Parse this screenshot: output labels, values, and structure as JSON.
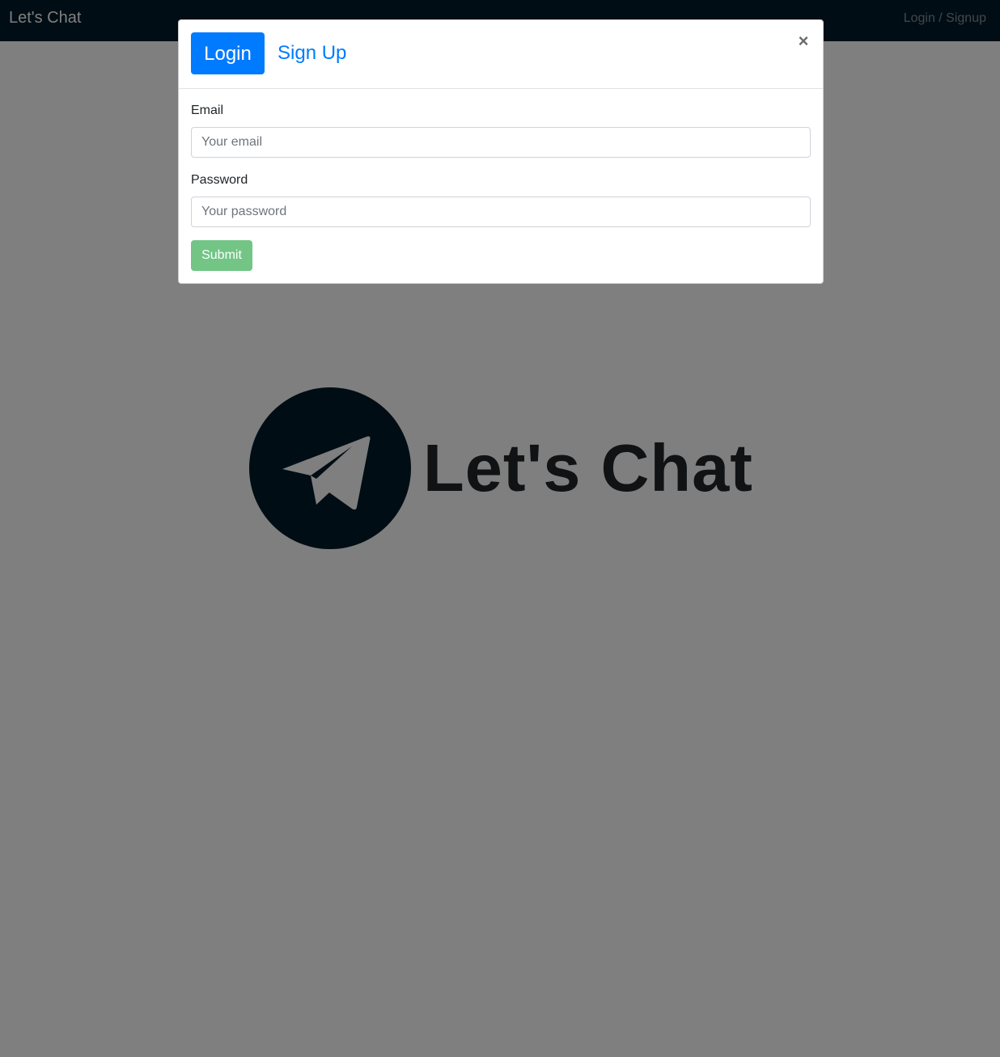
{
  "navbar": {
    "brand": "Let's Chat",
    "login_link": "Login / Signup"
  },
  "hero": {
    "title": "Let's Chat",
    "logo_icon": "paper-plane-icon"
  },
  "modal": {
    "tabs": {
      "login": "Login",
      "signup": "Sign Up"
    },
    "active_tab": "login",
    "close_label": "×",
    "email": {
      "label": "Email",
      "placeholder": "Your email",
      "value": ""
    },
    "password": {
      "label": "Password",
      "placeholder": "Your password",
      "value": ""
    },
    "submit_label": "Submit",
    "submit_disabled": true
  },
  "colors": {
    "navbar_bg": "#011b29",
    "primary": "#007bff",
    "success": "#28a745",
    "logo_circle": "#011b29"
  }
}
